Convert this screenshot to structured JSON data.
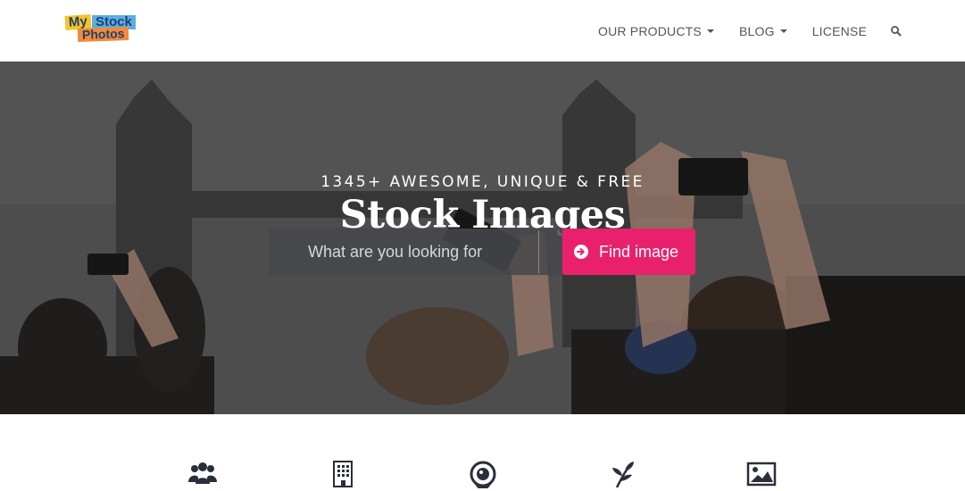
{
  "header": {
    "logo": {
      "line1a": "My",
      "line1b": "Stock",
      "line2": "Photos"
    },
    "nav": [
      {
        "label": "OUR PRODUCTS",
        "has_caret": true
      },
      {
        "label": "BLOG",
        "has_caret": true
      },
      {
        "label": "LICENSE",
        "has_caret": false
      }
    ],
    "search_icon": "search-icon"
  },
  "hero": {
    "subtitle": "1345+ AWESOME, UNIQUE & FREE",
    "title": "Stock Images",
    "search": {
      "placeholder": "What are you looking for",
      "value": ""
    },
    "button_label": "Find image",
    "button_icon": "arrow-circle-right-icon",
    "accent": "#e9216c"
  },
  "categories": [
    {
      "icon": "users-icon"
    },
    {
      "icon": "building-icon"
    },
    {
      "icon": "camera-lens-icon"
    },
    {
      "icon": "leaf-icon"
    },
    {
      "icon": "picture-icon"
    }
  ]
}
